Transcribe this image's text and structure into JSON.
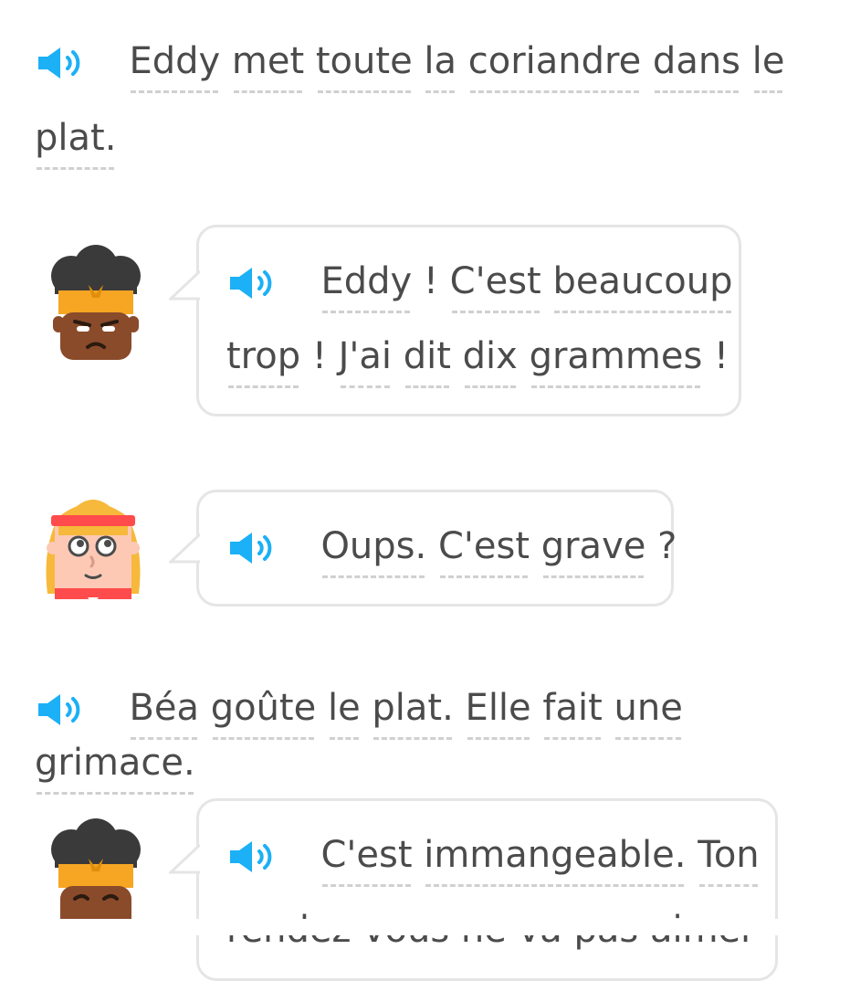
{
  "narration_1": {
    "line1": [
      "Eddy",
      "met",
      "toute",
      "la",
      "coriandre",
      "dans",
      "le"
    ],
    "line2": [
      "plat."
    ]
  },
  "dialog_1": {
    "speaker": "Eddy",
    "line1": [
      "Eddy",
      "!",
      "C'est",
      "beaucoup"
    ],
    "line2": [
      "trop",
      "!",
      "J'ai",
      "dit",
      "dix",
      "grammes",
      "!"
    ]
  },
  "dialog_2": {
    "speaker": "Béa",
    "line1": [
      "Oups.",
      "C'est",
      "grave",
      "?"
    ]
  },
  "narration_2": {
    "line1": [
      "Béa",
      "goûte",
      "le",
      "plat.",
      "Elle",
      "fait",
      "une",
      "grimace."
    ]
  },
  "dialog_3": {
    "speaker": "Eddy",
    "line1": [
      "C'est",
      "immangeable.",
      "Ton"
    ],
    "line2_partial": "rendez-vous ne va pas aimer"
  },
  "colors": {
    "speaker_blue": "#1cb0f6",
    "text": "#4b4b4b",
    "bubble_border": "#e5e5e5",
    "dots": "#d0d0d0"
  },
  "icons": {
    "audio": "speaker-icon",
    "eddy": "eddy-avatar",
    "bea": "bea-avatar"
  }
}
